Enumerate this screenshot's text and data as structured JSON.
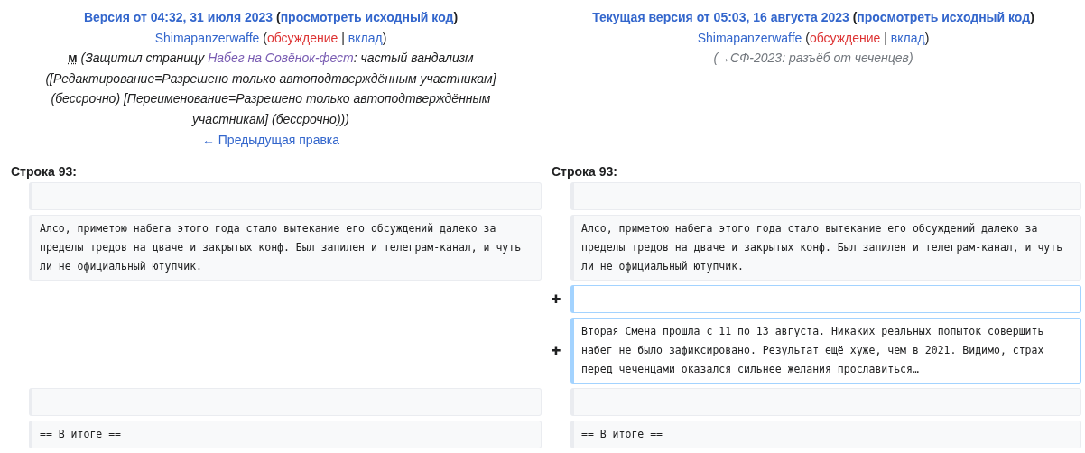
{
  "old": {
    "title": "Версия от 04:32, 31 июля 2023",
    "source_link": "просмотреть исходный код",
    "user": "Shimapanzerwaffe",
    "talk": "обсуждение",
    "contribs": "вклад",
    "minor": "м",
    "summary_before": "(Защитил страницу ",
    "summary_link": "Набег на Совёнок-фест",
    "summary_after": ": частый вандализм ([Редактирование=Разрешено только автоподтверждённым участникам] (бессрочно) [Переименование=Разрешено только автоподтверждённым участникам] (бессрочно)))",
    "nav_link": "← Предыдущая правка"
  },
  "new": {
    "title": "Текущая версия от 05:03, 16 августа 2023",
    "source_link": "просмотреть исходный код",
    "user": "Shimapanzerwaffe",
    "talk": "обсуждение",
    "contribs": "вклад",
    "summary": "(→СФ-2023: разъёб от чеченцев)"
  },
  "punctuation": {
    "open": "(",
    "close": ")",
    "separator": "|"
  },
  "line_labels": [
    "Строка 93:",
    "Строка 93:"
  ],
  "rows": [
    {
      "kind": "context",
      "left": "",
      "right": ""
    },
    {
      "kind": "context",
      "left": "Алсо, приметою набега этого года стало вытекание его обсуждений далеко за пределы тредов на дваче и закрытых конф. Был запилен и телеграм-канал, и чуть ли не официальный ютупчик.",
      "right": "Алсо, приметою набега этого года стало вытекание его обсуждений далеко за пределы тредов на дваче и закрытых конф. Был запилен и телеграм-канал, и чуть ли не официальный ютупчик."
    },
    {
      "kind": "added",
      "marker": "✚",
      "right": ""
    },
    {
      "kind": "added",
      "marker": "✚",
      "right": "Вторая Смена прошла с 11 по 13 августа. Никаких реальных попыток совершить набег не было зафиксировано. Результат ещё хуже, чем в 2021. Видимо, страх перед чеченцами оказался сильнее желания прославиться…"
    },
    {
      "kind": "context",
      "left": "",
      "right": ""
    },
    {
      "kind": "context",
      "left": "== В итоге ==",
      "right": "== В итоге =="
    }
  ]
}
